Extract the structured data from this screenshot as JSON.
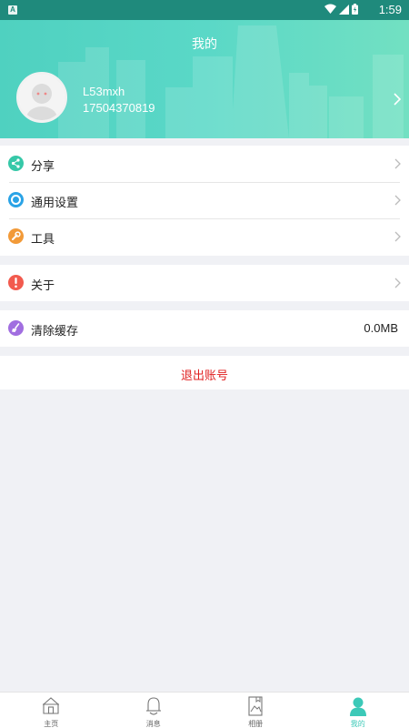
{
  "status_bar": {
    "notif_letter": "A",
    "time": "1:59"
  },
  "header": {
    "title": "我的"
  },
  "user": {
    "name": "L53mxh",
    "phone": "17504370819"
  },
  "menu_group1": [
    {
      "label": "分享",
      "icon": "share-icon",
      "color": "#36c8a8"
    },
    {
      "label": "通用设置",
      "icon": "settings-icon",
      "color": "#2aa3e6"
    },
    {
      "label": "工具",
      "icon": "tools-icon",
      "color": "#f29a38"
    }
  ],
  "menu_group2": [
    {
      "label": "关于",
      "icon": "info-icon",
      "color": "#f25a4e"
    }
  ],
  "menu_group3": [
    {
      "label": "清除缓存",
      "icon": "broom-icon",
      "color": "#a16ee0",
      "value": "0.0MB"
    }
  ],
  "logout": {
    "label": "退出账号",
    "color": "#e02020"
  },
  "tabbar": [
    {
      "label": "主页",
      "icon": "home-icon"
    },
    {
      "label": "消息",
      "icon": "bell-icon"
    },
    {
      "label": "相册",
      "icon": "album-icon"
    },
    {
      "label": "我的",
      "icon": "profile-icon",
      "active": true
    }
  ],
  "colors": {
    "accent": "#3cc9b8",
    "header_start": "#4fd1c0",
    "header_end": "#72e0c2"
  }
}
